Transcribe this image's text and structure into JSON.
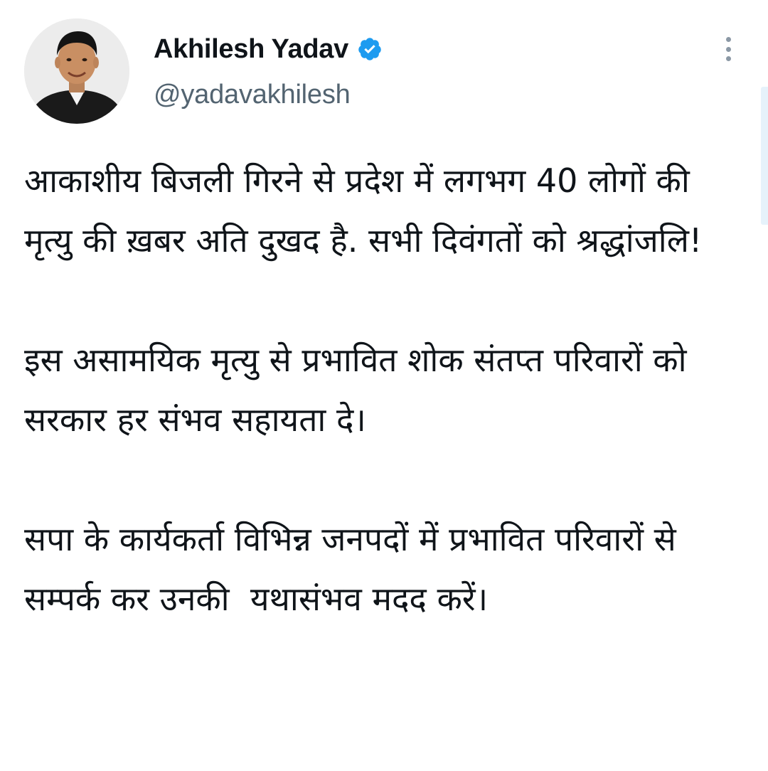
{
  "tweet": {
    "author": {
      "display_name": "Akhilesh Yadav",
      "handle": "@yadavakhilesh",
      "verified": true,
      "verified_icon": "verified-badge-icon",
      "avatar_icon": "profile-photo"
    },
    "more_icon": "more-vertical-icon",
    "paragraphs": [
      "आकाशीय बिजली गिरने से प्रदेश में लगभग 40 लोगों की मृत्यु की ख़बर अति दुखद है. सभी दिवंगतों को श्रद्धांजलि!",
      "इस असामयिक मृत्यु से प्रभावित शोक संतप्त परिवारों को सरकार हर संभव सहायता दे।",
      "सपा के कार्यकर्ता विभिन्न जनपदों में प्रभावित परिवारों से सम्पर्क कर उनकी  यथासंभव मदद करें।"
    ]
  },
  "colors": {
    "verified_blue": "#1d9bf0",
    "handle_gray": "#536471",
    "text_dark": "#0f1419",
    "dots_gray": "#8b98a5"
  }
}
